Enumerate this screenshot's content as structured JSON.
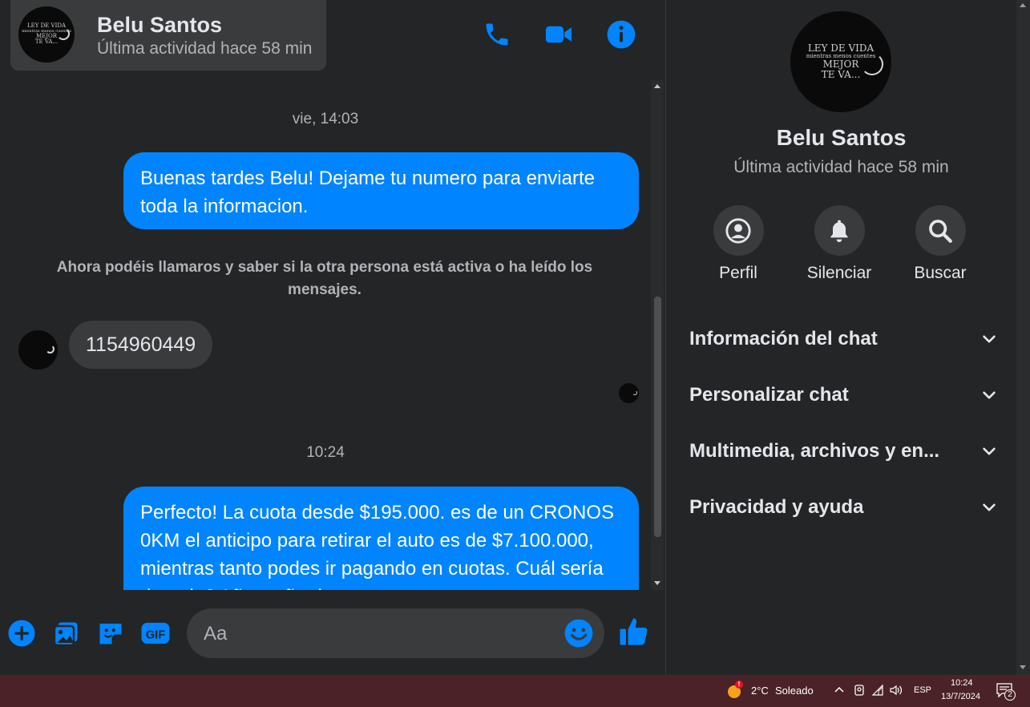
{
  "contact": {
    "name": "Belu Santos",
    "status": "Última actividad hace 58 min",
    "avatar_text": [
      "LEY DE VIDA",
      "mientras menos cuentes",
      "MEJOR",
      "TE VA..."
    ]
  },
  "messages": {
    "timestamp1": "vie, 14:03",
    "out1": "Buenas tardes Belu! Dejame tu numero para enviarte toda la informacion.",
    "system": "Ahora podéis llamaros y saber si la otra persona está activa o ha leído los mensajes.",
    "in1": "1154960449",
    "timestamp2": "10:24",
    "out2": "Perfecto! La cuota desde $195.000. es de un CRONOS 0KM el anticipo para retirar el auto es de $7.100.000, mientras tanto podes ir pagando en cuotas. Cuál sería de todo? Año y año de"
  },
  "composer": {
    "placeholder": "Aa"
  },
  "side_panel": {
    "actions": [
      {
        "label": "Perfil",
        "icon": "profile-icon"
      },
      {
        "label": "Silenciar",
        "icon": "bell-icon"
      },
      {
        "label": "Buscar",
        "icon": "search-icon"
      }
    ],
    "sections": [
      "Información del chat",
      "Personalizar chat",
      "Multimedia, archivos y en...",
      "Privacidad y ayuda"
    ]
  },
  "taskbar": {
    "weather_temp": "2°C",
    "weather_desc": "Soleado",
    "weather_badge": "!",
    "lang": "ESP",
    "time": "10:24",
    "date": "13/7/2024",
    "notif_count": "2"
  },
  "colors": {
    "accent": "#0084ff",
    "bg": "#242526",
    "surface": "#3a3b3c",
    "taskbar": "#4a2227"
  }
}
